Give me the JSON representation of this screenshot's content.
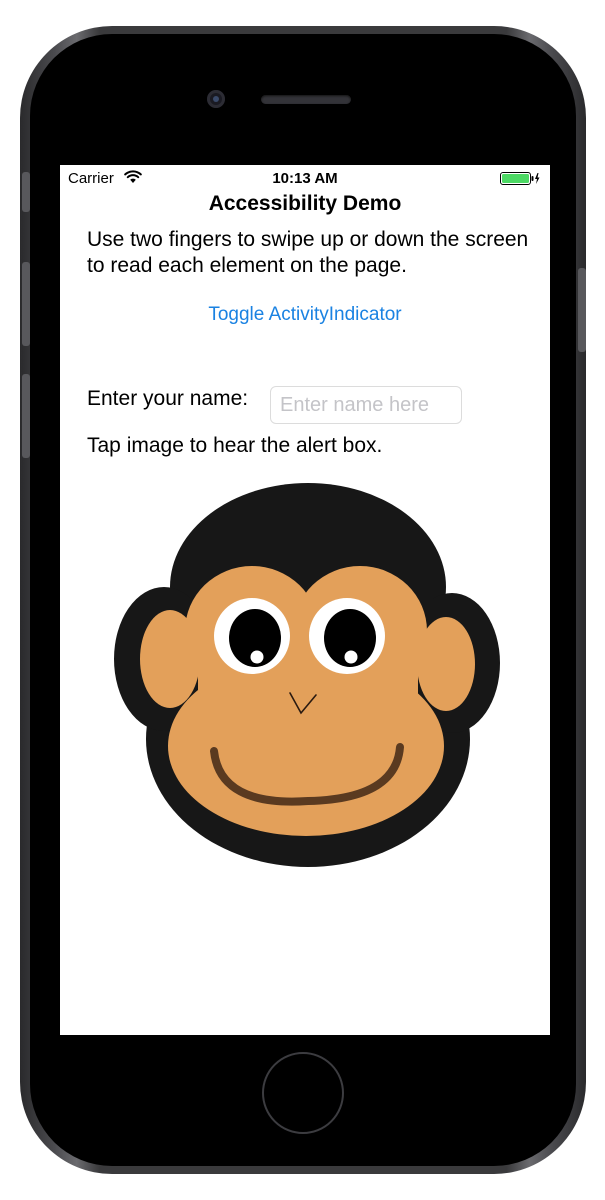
{
  "status_bar": {
    "carrier": "Carrier",
    "time": "10:13 AM",
    "wifi_icon": "wifi-icon",
    "battery_icon": "battery-charging-icon",
    "battery_color": "#4cd964"
  },
  "nav": {
    "title": "Accessibility Demo"
  },
  "main": {
    "instructions": "Use two fingers to swipe up or down the screen to read each element on the page.",
    "toggle_button_label": "Toggle ActivityIndicator",
    "name_label": "Enter your name:",
    "name_input": {
      "value": "",
      "placeholder": "Enter name here"
    },
    "tap_instruction": "Tap image to hear the alert box.",
    "image_icon": "monkey-face-icon"
  },
  "colors": {
    "accent": "#1a82e2",
    "monkey_fur": "#171717",
    "monkey_skin": "#e3a05a",
    "monkey_mouth": "#5a3a20"
  }
}
